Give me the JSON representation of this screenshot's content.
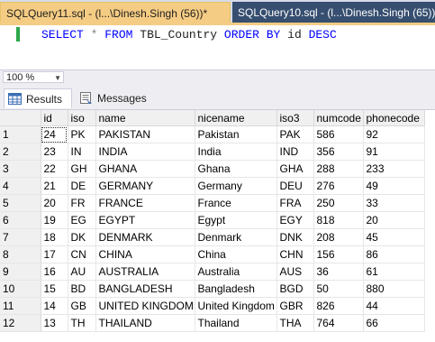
{
  "tabs": [
    {
      "label": "SQLQuery11.sql - (l...\\Dinesh.Singh (56))*",
      "active": true
    },
    {
      "label": "SQLQuery10.sql - (l...\\Dinesh.Singh (65))*",
      "active": false
    }
  ],
  "editor": {
    "kw_select": "SELECT",
    "star": "*",
    "kw_from": "FROM",
    "table": "TBL_Country",
    "kw_order_by": "ORDER BY",
    "col": "id",
    "kw_desc": "DESC"
  },
  "zoom": {
    "value": "100 %"
  },
  "result_tabs": {
    "results": "Results",
    "messages": "Messages"
  },
  "grid": {
    "columns": [
      "id",
      "iso",
      "name",
      "nicename",
      "iso3",
      "numcode",
      "phonecode"
    ],
    "rows": [
      [
        "1",
        "24",
        "PK",
        "PAKISTAN",
        "Pakistan",
        "PAK",
        "586",
        "92"
      ],
      [
        "2",
        "23",
        "IN",
        "INDIA",
        "India",
        "IND",
        "356",
        "91"
      ],
      [
        "3",
        "22",
        "GH",
        "GHANA",
        "Ghana",
        "GHA",
        "288",
        "233"
      ],
      [
        "4",
        "21",
        "DE",
        "GERMANY",
        "Germany",
        "DEU",
        "276",
        "49"
      ],
      [
        "5",
        "20",
        "FR",
        "FRANCE",
        "France",
        "FRA",
        "250",
        "33"
      ],
      [
        "6",
        "19",
        "EG",
        "EGYPT",
        "Egypt",
        "EGY",
        "818",
        "20"
      ],
      [
        "7",
        "18",
        "DK",
        "DENMARK",
        "Denmark",
        "DNK",
        "208",
        "45"
      ],
      [
        "8",
        "17",
        "CN",
        "CHINA",
        "China",
        "CHN",
        "156",
        "86"
      ],
      [
        "9",
        "16",
        "AU",
        "AUSTRALIA",
        "Australia",
        "AUS",
        "36",
        "61"
      ],
      [
        "10",
        "15",
        "BD",
        "BANGLADESH",
        "Bangladesh",
        "BGD",
        "50",
        "880"
      ],
      [
        "11",
        "14",
        "GB",
        "UNITED KINGDOM",
        "United Kingdom",
        "GBR",
        "826",
        "44"
      ],
      [
        "12",
        "13",
        "TH",
        "THAILAND",
        "Thailand",
        "THA",
        "764",
        "66"
      ]
    ]
  },
  "colors": {
    "active_tab": "#f5cc84",
    "inactive_tab": "#364e6f",
    "keyword": "#0000ff",
    "gutter_changed": "#2ca84a"
  }
}
